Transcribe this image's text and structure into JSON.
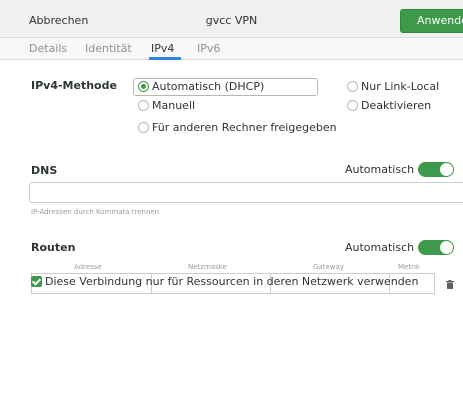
{
  "header": {
    "cancel_label": "Abbrechen",
    "title": "gvcc VPN",
    "apply_label": "Anwenden"
  },
  "tabs": [
    {
      "label": "Details",
      "active": false
    },
    {
      "label": "Identität",
      "active": false
    },
    {
      "label": "IPv4",
      "active": true
    },
    {
      "label": "IPv6",
      "active": false
    }
  ],
  "ipv4": {
    "method_label": "IPv4-Methode",
    "options": {
      "auto": {
        "label": "Automatisch (DHCP)",
        "checked": true
      },
      "link_local": {
        "label": "Nur Link-Local",
        "checked": false
      },
      "manual": {
        "label": "Manuell",
        "checked": false
      },
      "disable": {
        "label": "Deaktivieren",
        "checked": false
      },
      "shared": {
        "label": "Für anderen Rechner freigegeben",
        "checked": false
      }
    }
  },
  "dns": {
    "label": "DNS",
    "auto_label": "Automatisch",
    "auto_enabled": true,
    "value": "",
    "hint": "IP-Adressen durch Kommata trennen"
  },
  "routes": {
    "label": "Routen",
    "auto_label": "Automatisch",
    "auto_enabled": true,
    "columns": [
      "Adresse",
      "Netzmaske",
      "Gateway",
      "Metrik"
    ],
    "row": [
      "",
      "",
      "",
      ""
    ]
  },
  "only_local": {
    "label": "Diese Verbindung nur für Ressourcen in deren Netzwerk verwenden",
    "checked": true
  },
  "colors": {
    "accent_green": "#3e9a4a",
    "tab_highlight": "#3584e4"
  }
}
